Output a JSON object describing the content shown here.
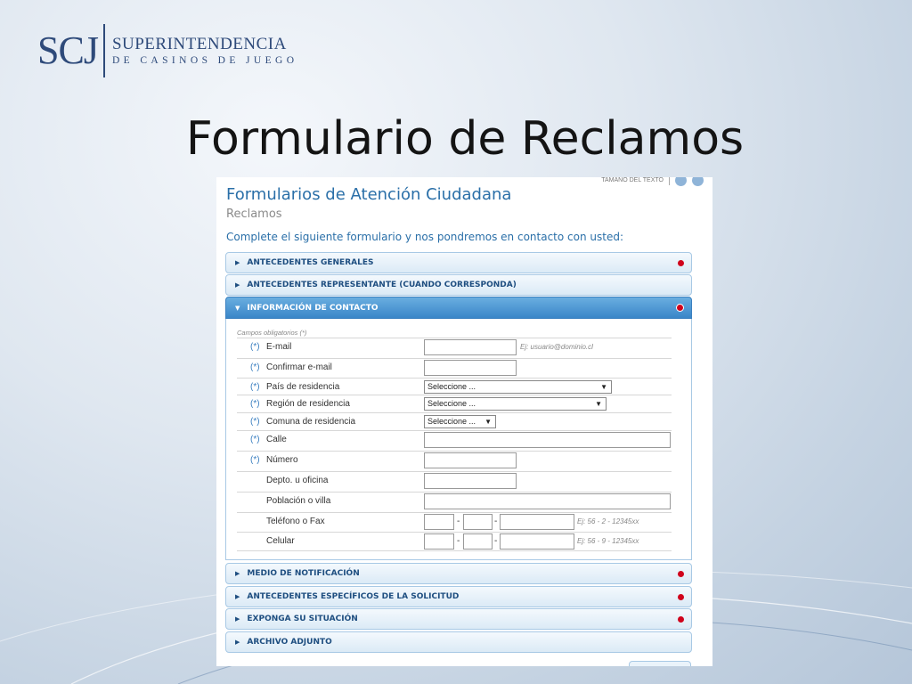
{
  "logo": {
    "mark": "SCJ",
    "line1": "SUPERINTENDENCIA",
    "line2": "DE CASINOS DE JUEGO"
  },
  "slide_title": "Formulario de Reclamos",
  "panel": {
    "text_size_label": "TAMAÑO DEL TEXTO",
    "title": "Formularios de Atención Ciudadana",
    "subtitle": "Reclamos",
    "intro": "Complete el siguiente formulario y nos pondremos en contacto con usted:",
    "sections": [
      {
        "label": "ANTECEDENTES GENERALES",
        "required": true
      },
      {
        "label": "ANTECEDENTES REPRESENTANTE (CUANDO CORRESPONDA)",
        "required": false
      },
      {
        "label": "INFORMACIÓN DE CONTACTO",
        "required": true,
        "expanded": true
      },
      {
        "label": "MEDIO DE NOTIFICACIÓN",
        "required": true
      },
      {
        "label": "ANTECEDENTES ESPECÍFICOS DE LA SOLICITUD",
        "required": true
      },
      {
        "label": "EXPONGA SU SITUACIÓN",
        "required": true
      },
      {
        "label": "ARCHIVO ADJUNTO",
        "required": false
      }
    ],
    "mandatory_note": "Campos obligatorios (*)",
    "required_mark": "(*)",
    "dash": "-",
    "fields": {
      "email": {
        "label": "E-mail",
        "hint": "Ej: usuario@dominio.cl"
      },
      "confirm_email": {
        "label": "Confirmar e-mail"
      },
      "country": {
        "label": "País de residencia",
        "value": "Seleccione ..."
      },
      "region": {
        "label": "Región de residencia",
        "value": "Seleccione ..."
      },
      "comuna": {
        "label": "Comuna de residencia",
        "value": "Seleccione ..."
      },
      "street": {
        "label": "Calle"
      },
      "number": {
        "label": "Número"
      },
      "apt": {
        "label": "Depto. u oficina"
      },
      "village": {
        "label": "Población o villa"
      },
      "phone": {
        "label": "Teléfono o Fax",
        "hint": "Ej: 56 - 2 - 12345xx"
      },
      "mobile": {
        "label": "Celular",
        "hint": "Ej: 56 - 9 - 12345xx"
      }
    }
  },
  "colors": {
    "accent": "#2a6fa8",
    "required_dot": "#d0021b",
    "active_bar": "#3a86c8"
  },
  "icons": {
    "collapsed": "caret-right-icon",
    "expanded": "caret-down-icon",
    "dropdown": "caret-down-icon"
  }
}
